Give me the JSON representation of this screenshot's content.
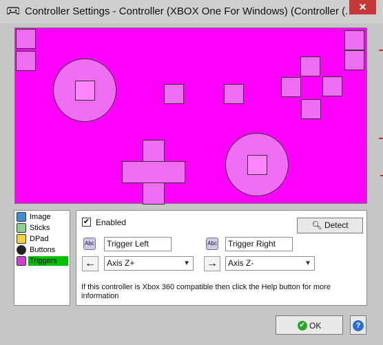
{
  "window": {
    "title": "Controller Settings - Controller (XBOX One For Windows) (Controller (...",
    "close_label": "✕"
  },
  "colors": {
    "pad_background": "#ff00ff",
    "button_fill": "#ef6ef4",
    "selected_item": "#00c000"
  },
  "nav": {
    "items": [
      {
        "label": "Image",
        "icon": "image-icon"
      },
      {
        "label": "Sticks",
        "icon": "sticks-icon"
      },
      {
        "label": "DPad",
        "icon": "dpad-icon"
      },
      {
        "label": "Buttons",
        "icon": "buttons-icon"
      },
      {
        "label": "Triggers",
        "icon": "triggers-icon",
        "selected": true
      }
    ]
  },
  "panel": {
    "enabled_label": "Enabled",
    "enabled_checked": true,
    "detect_label": "Detect",
    "left": {
      "name": "Trigger Left",
      "axis": "Axis Z+",
      "abc": "Abc",
      "arrow": "←"
    },
    "right": {
      "name": "Trigger Right",
      "axis": "Axis Z-",
      "abc": "Abc",
      "arrow": "→"
    },
    "info": "If this controller is Xbox 360 compatible then click the Help button for more information"
  },
  "footer": {
    "ok_label": "OK",
    "help_label": "?"
  }
}
